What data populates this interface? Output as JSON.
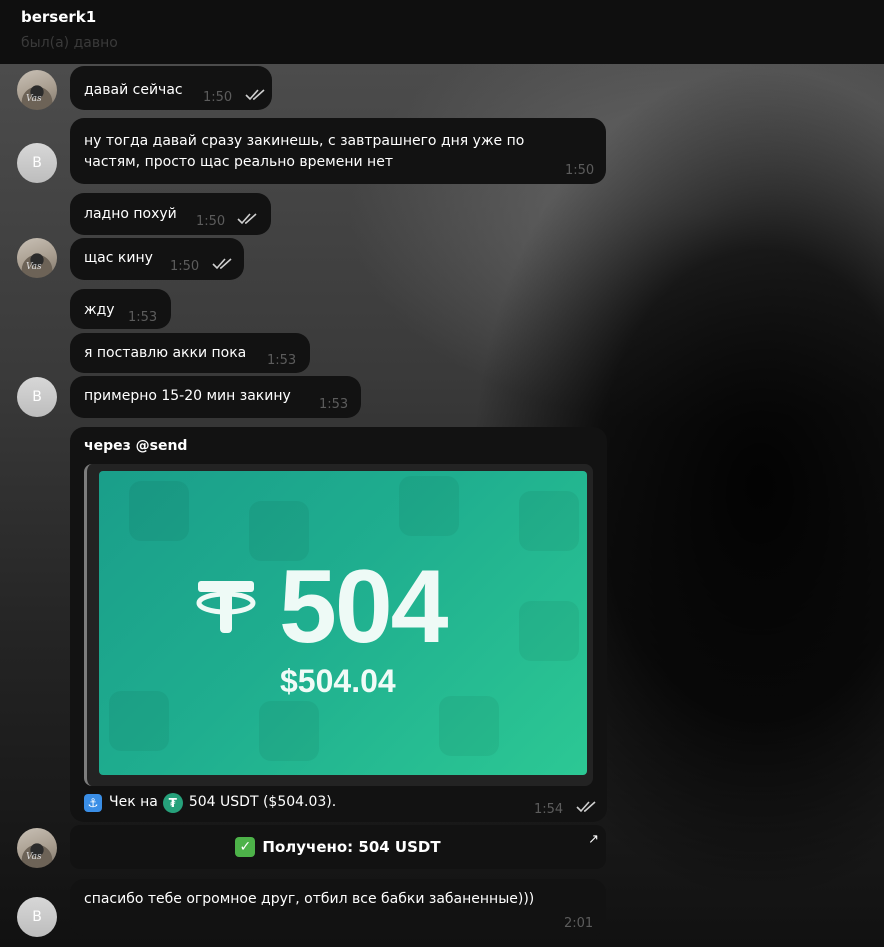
{
  "header": {
    "title": "berserk1",
    "status": "был(а) давно"
  },
  "avatars": {
    "self_tag": "Vas",
    "other_letter": "B"
  },
  "messages": [
    {
      "text": "давай сейчас",
      "time": "1:50",
      "read": true
    },
    {
      "text_line1": "ну тогда давай сразу закинешь, с завтрашнего дня уже по",
      "text_line2": "частям, просто щас реально времени нет",
      "time": "1:50"
    },
    {
      "text": "ладно похуй",
      "time": "1:50",
      "read": true
    },
    {
      "text": "щас кину",
      "time": "1:50",
      "read": true
    },
    {
      "text": "жду",
      "time": "1:53"
    },
    {
      "text": "я поставлю акки пока",
      "time": "1:53"
    },
    {
      "text": "примерно 15-20 мин закину",
      "time": "1:53"
    },
    {
      "text": "спасибо тебе огромное друг, отбил все бабки забаненные)))",
      "time": "2:01"
    }
  ],
  "check_message": {
    "title": "через @send",
    "card_amount": "504",
    "card_usd": "$504.04",
    "caption_prefix": "Чек на",
    "caption_value": "504 USDT ($504.03).",
    "time": "1:54",
    "read": true,
    "icons": {
      "anchor": "anchor-emoji-icon",
      "coin": "usdt-coin-icon",
      "logo": "tether-logo-icon"
    }
  },
  "received_message": {
    "text": "Получено: 504 USDT",
    "icon": "green-check-icon"
  },
  "colors": {
    "bubble": "#121212",
    "card_start": "#1a9e8a",
    "card_end": "#2cc894",
    "time": "#5c5c5c",
    "header": "#0f0f0f"
  }
}
